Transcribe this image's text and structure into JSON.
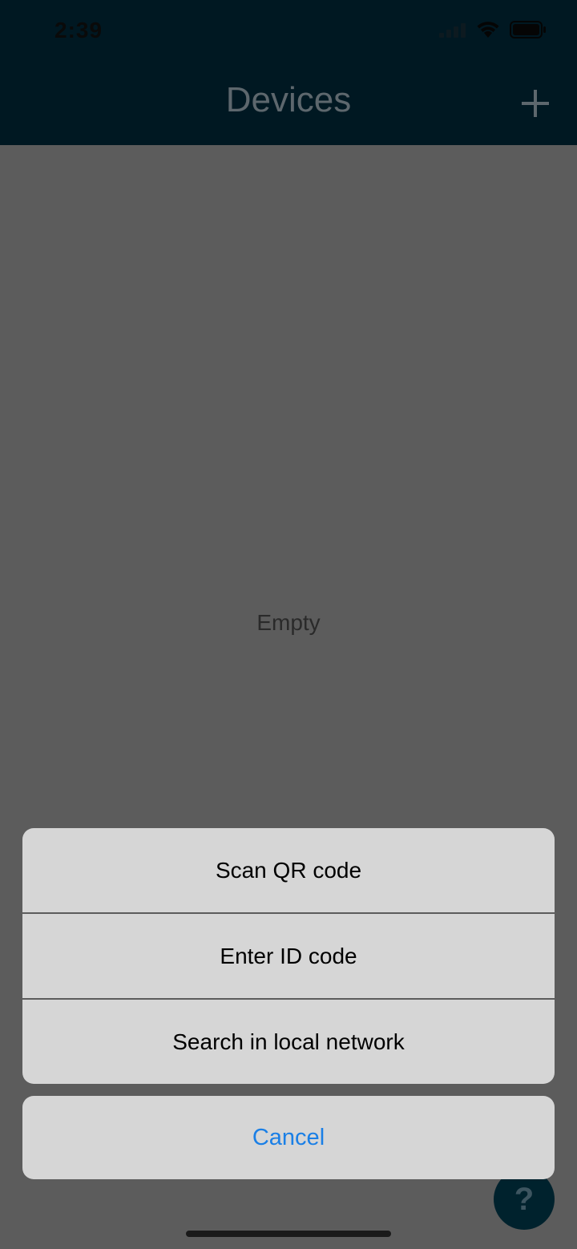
{
  "status_bar": {
    "time": "2:39"
  },
  "nav": {
    "title": "Devices",
    "add_icon": "plus-icon"
  },
  "content": {
    "empty_label": "Empty"
  },
  "action_sheet": {
    "items": [
      {
        "label": "Scan QR code"
      },
      {
        "label": "Enter ID code"
      },
      {
        "label": "Search in local network"
      }
    ],
    "cancel_label": "Cancel"
  },
  "help": {
    "label": "?"
  },
  "colors": {
    "nav_background": "#001822",
    "overlay_background": "#5c5c5c",
    "sheet_background": "#d6d6d6",
    "accent": "#1a7fe6"
  }
}
